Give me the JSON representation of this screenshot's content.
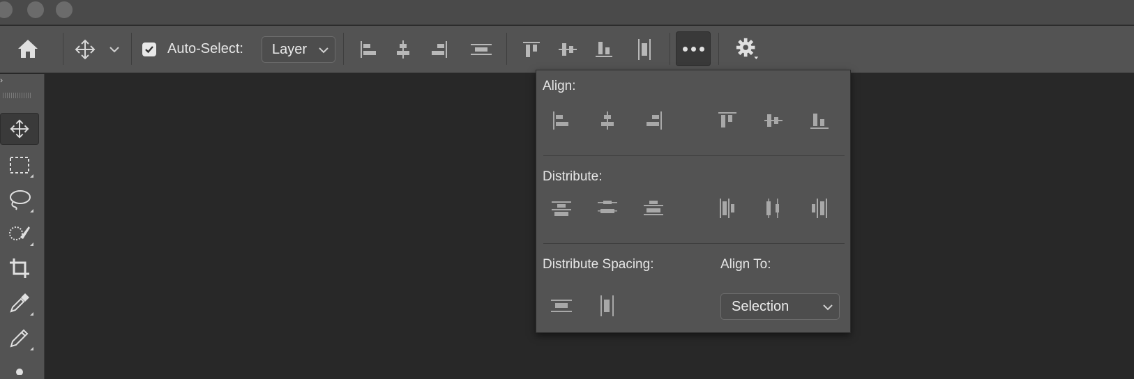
{
  "options_bar": {
    "auto_select_label": "Auto-Select:",
    "auto_select_checked": true,
    "auto_select_target": "Layer"
  },
  "align_popup": {
    "align_label": "Align:",
    "distribute_label": "Distribute:",
    "distribute_spacing_label": "Distribute Spacing:",
    "align_to_label": "Align To:",
    "align_to_value": "Selection"
  },
  "icons": {
    "home": "home-icon",
    "move": "move-icon",
    "settings": "gear-icon",
    "more": "more-options-icon"
  },
  "colors": {
    "panel": "#535353",
    "canvas": "#282828",
    "icon": "#b8b8b8"
  }
}
